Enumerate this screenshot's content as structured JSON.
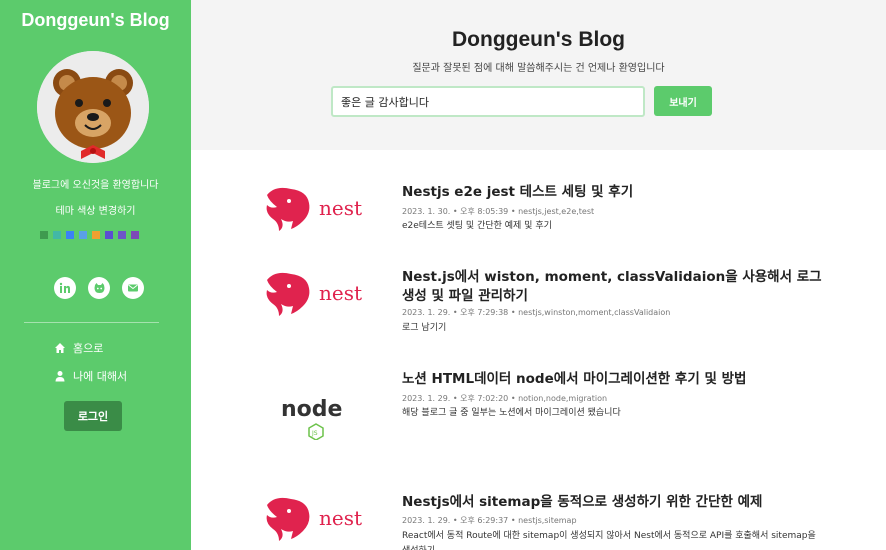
{
  "sidebar": {
    "blog_title": "Donggeun's Blog",
    "welcome": "블로그에 오신것을 환영합니다",
    "theme_link": "테마 색상 변경하기",
    "swatch_colors": [
      "#3f9a4f",
      "#42b8a6",
      "#3b82f6",
      "#5aa0e6",
      "#f0a030",
      "#5b4fd1",
      "#6d56c9",
      "#7d49b8"
    ],
    "social": [
      "linkedin-icon",
      "github-icon",
      "mail-icon"
    ],
    "nav": {
      "home": "홈으로",
      "about": "나에 대해서"
    },
    "login": "로그인"
  },
  "header": {
    "title": "Donggeun's Blog",
    "subtitle": "질문과 잘못된 점에 대해 말씀해주시는 건 언제나 환영입니다",
    "input_value": "좋은 글 감사합니다",
    "send_label": "보내기"
  },
  "posts": [
    {
      "thumb": "nest",
      "title": "Nestjs e2e jest 테스트 세팅 및 후기",
      "date": "2023. 1. 30.",
      "time": "오후 8:05:39",
      "tags": "nestjs,jest,e2e,test",
      "desc": "e2e테스트 셋팅 및 간단한 예제 및 후기"
    },
    {
      "thumb": "nest",
      "title": "Nest.js에서 wiston, moment, classValidaion을 사용해서 로그 생성 및 파일 관리하기",
      "date": "2023. 1. 29.",
      "time": "오후 7:29:38",
      "tags": "nestjs,winston,moment,classValidaion",
      "desc": "로그 남기기"
    },
    {
      "thumb": "node",
      "title": "노션 HTML데이터 node에서 마이그레이션한 후기 및 방법",
      "date": "2023. 1. 29.",
      "time": "오후 7:02:20",
      "tags": "notion,node,migration",
      "desc": "해당 블로그 글 중 일부는 노션에서 마이그레이션 됐습니다"
    },
    {
      "thumb": "nest",
      "title": "Nestjs에서 sitemap을 동적으로 생성하기 위한 간단한 예제",
      "date": "2023. 1. 29.",
      "time": "오후 6:29:37",
      "tags": "nestjs,sitemap",
      "desc": "React에서 동적 Route에 대한 sitemap이 생성되지 않아서 Nest에서 동적으로 API를 호출해서 sitemap을 생성하기"
    }
  ],
  "logo_text": {
    "nest": "nest",
    "node": "node",
    "js": "JS"
  },
  "meta_sep": "•",
  "colors": {
    "accent": "#5ccb6c",
    "login_bg": "#3a8c47",
    "nest_red": "#e0234e",
    "header_bg": "#f4f4f4"
  }
}
